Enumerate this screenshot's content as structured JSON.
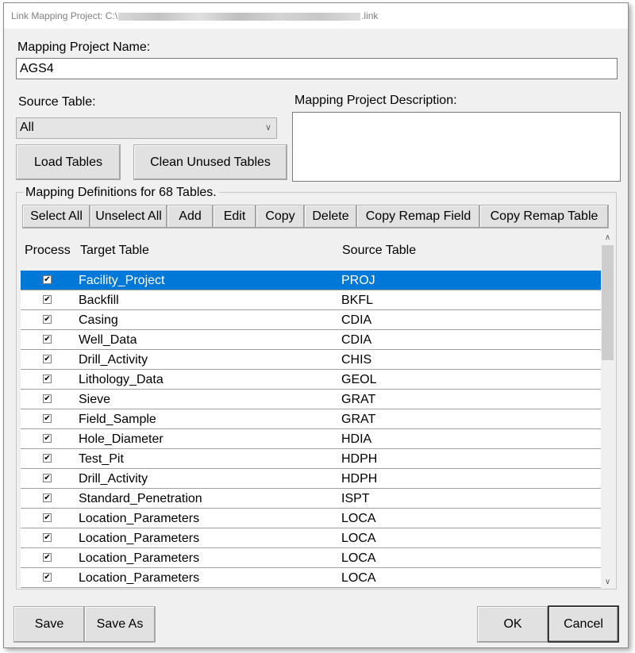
{
  "window": {
    "title_prefix": "Link Mapping Project: C:\\",
    "title_suffix": ".link"
  },
  "project_name": {
    "label": "Mapping Project Name:",
    "value": "AGS4"
  },
  "source_table": {
    "label": "Source Table:",
    "selected": "All"
  },
  "description": {
    "label": "Mapping Project Description:",
    "value": ""
  },
  "buttons": {
    "load_tables": "Load Tables",
    "clean_unused_tables": "Clean Unused Tables",
    "save": "Save",
    "save_as": "Save As",
    "ok": "OK",
    "cancel": "Cancel"
  },
  "mapping_group": {
    "legend": "Mapping Definitions for 68 Tables.",
    "toolbar": {
      "select_all": "Select All",
      "unselect_all": "Unselect All",
      "add": "Add",
      "edit": "Edit",
      "copy": "Copy",
      "delete": "Delete",
      "copy_remap_field": "Copy Remap Field",
      "copy_remap_table": "Copy Remap Table"
    },
    "columns": {
      "process": "Process",
      "target": "Target Table",
      "source": "Source Table"
    },
    "rows": [
      {
        "process": true,
        "target": "Facility_Project",
        "source": "PROJ",
        "selected": true
      },
      {
        "process": true,
        "target": "Backfill",
        "source": "BKFL"
      },
      {
        "process": true,
        "target": "Casing",
        "source": "CDIA"
      },
      {
        "process": true,
        "target": "Well_Data",
        "source": "CDIA"
      },
      {
        "process": true,
        "target": "Drill_Activity",
        "source": "CHIS"
      },
      {
        "process": true,
        "target": "Lithology_Data",
        "source": "GEOL"
      },
      {
        "process": true,
        "target": "Sieve",
        "source": "GRAT"
      },
      {
        "process": true,
        "target": "Field_Sample",
        "source": "GRAT"
      },
      {
        "process": true,
        "target": "Hole_Diameter",
        "source": "HDIA"
      },
      {
        "process": true,
        "target": "Test_Pit",
        "source": "HDPH"
      },
      {
        "process": true,
        "target": "Drill_Activity",
        "source": "HDPH"
      },
      {
        "process": true,
        "target": "Standard_Penetration",
        "source": "ISPT"
      },
      {
        "process": true,
        "target": "Location_Parameters",
        "source": "LOCA"
      },
      {
        "process": true,
        "target": "Location_Parameters",
        "source": "LOCA"
      },
      {
        "process": true,
        "target": "Location_Parameters",
        "source": "LOCA"
      },
      {
        "process": true,
        "target": "Location_Parameters",
        "source": "LOCA"
      }
    ],
    "scroll_position": 0
  },
  "colors": {
    "selection": "#0078d7",
    "dialog_bg": "#f0f0f0"
  }
}
